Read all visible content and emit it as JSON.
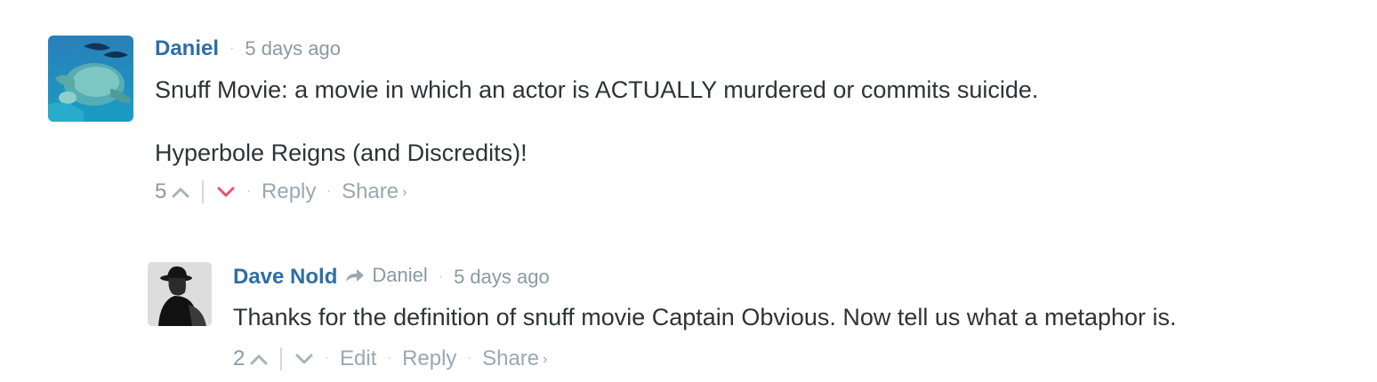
{
  "colors": {
    "author": "#2e6ea5",
    "meta": "#8a9aa4",
    "text": "#2e3436",
    "downvote_active": "#e5566b",
    "icon_inactive": "#a7b3ba"
  },
  "comments": [
    {
      "author": "Daniel",
      "time": "5 days ago",
      "avatar_icon": "sea-turtle-avatar",
      "paragraphs": [
        "Snuff Movie: a movie in which an actor is ACTUALLY murdered or commits suicide.",
        "Hyperbole Reigns (and Discredits)!"
      ],
      "votes": "5",
      "downvoted": true,
      "actions": {
        "reply": "Reply",
        "share": "Share",
        "share_chevron": "›"
      }
    },
    {
      "author": "Dave Nold",
      "reply_to": "Daniel",
      "time": "5 days ago",
      "avatar_icon": "man-in-hat-avatar",
      "paragraphs": [
        "Thanks for the definition of snuff movie Captain Obvious. Now tell us what a metaphor is."
      ],
      "votes": "2",
      "downvoted": false,
      "actions": {
        "edit": "Edit",
        "reply": "Reply",
        "share": "Share",
        "share_chevron": "›"
      }
    }
  ],
  "separator": "·"
}
